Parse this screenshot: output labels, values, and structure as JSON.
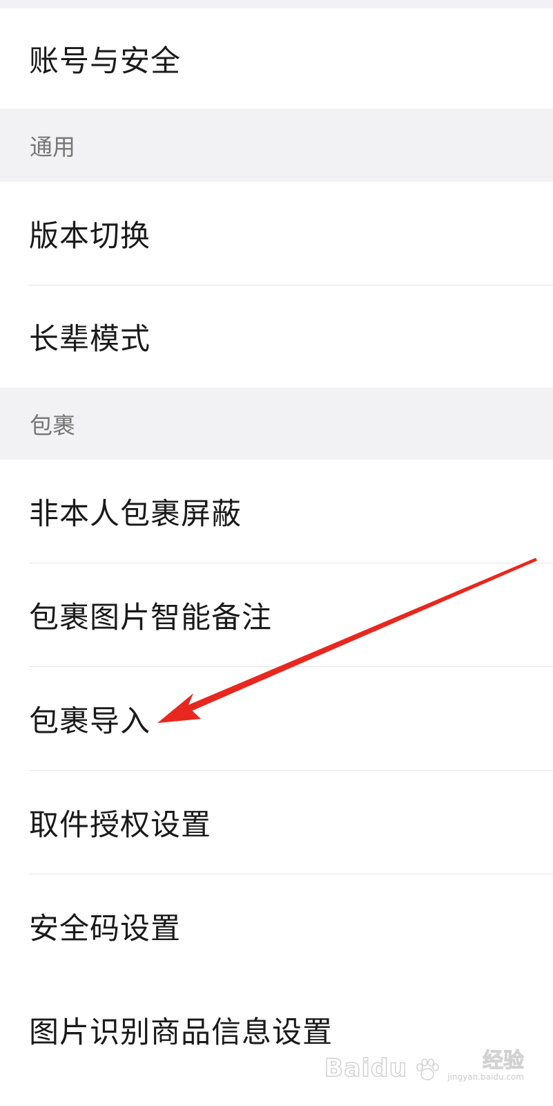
{
  "account_group": {
    "items": [
      {
        "label": "账号与安全"
      }
    ]
  },
  "general_section": {
    "header": "通用",
    "items": [
      {
        "label": "版本切换"
      },
      {
        "label": "长辈模式"
      }
    ]
  },
  "package_section": {
    "header": "包裹",
    "items": [
      {
        "label": "非本人包裹屏蔽"
      },
      {
        "label": "包裹图片智能备注"
      },
      {
        "label": "包裹导入"
      },
      {
        "label": "取件授权设置"
      },
      {
        "label": "安全码设置"
      },
      {
        "label": "图片识别商品信息设置"
      }
    ]
  },
  "annotation": {
    "arrow_color": "#e8281f",
    "points_to": "包裹导入"
  },
  "watermark": {
    "logo": "Baidu",
    "title": "经验",
    "url": "jingyan.baidu.com"
  },
  "colors": {
    "page_background": "#f2f2f4",
    "row_background": "#ffffff",
    "row_text": "#1a1a1a",
    "section_header_text": "#767676",
    "divider": "#e3e3e3"
  }
}
